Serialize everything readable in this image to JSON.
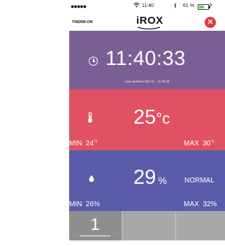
{
  "status_bar": {
    "signal": "●●●●●",
    "time": "11:40",
    "bluetooth_glyph": "∦",
    "battery_pct": "61 %",
    "battery_level": 0.61
  },
  "header": {
    "left_label": "THERM-ON",
    "logo_text": "iROX",
    "close_glyph": "✕"
  },
  "clock_panel": {
    "time": "11:40:33",
    "updated": "Last updated: Mar 21 - 11:39:48"
  },
  "temperature_panel": {
    "value": "25",
    "unit": "°c",
    "min_label": "MIN",
    "min_value": "24",
    "max_label": "MAX",
    "max_value": "30",
    "min_unit": "°c",
    "max_unit": "°c"
  },
  "humidity_panel": {
    "value": "29",
    "unit": "%",
    "status": "NORMAL",
    "min_label": "MIN",
    "min_value": "26%",
    "max_label": "MAX",
    "max_value": "32%"
  },
  "tabs": [
    {
      "label": "1"
    },
    {
      "label": ""
    },
    {
      "label": ""
    }
  ],
  "colors": {
    "clock": "#7a5f94",
    "temperature": "#e05162",
    "humidity": "#5b5ca9",
    "close": "#e8363c"
  },
  "icons": [
    "wifi-icon",
    "bluetooth-icon",
    "battery-icon",
    "close-icon",
    "clock-icon",
    "thermometer-icon",
    "droplet-icon"
  ]
}
